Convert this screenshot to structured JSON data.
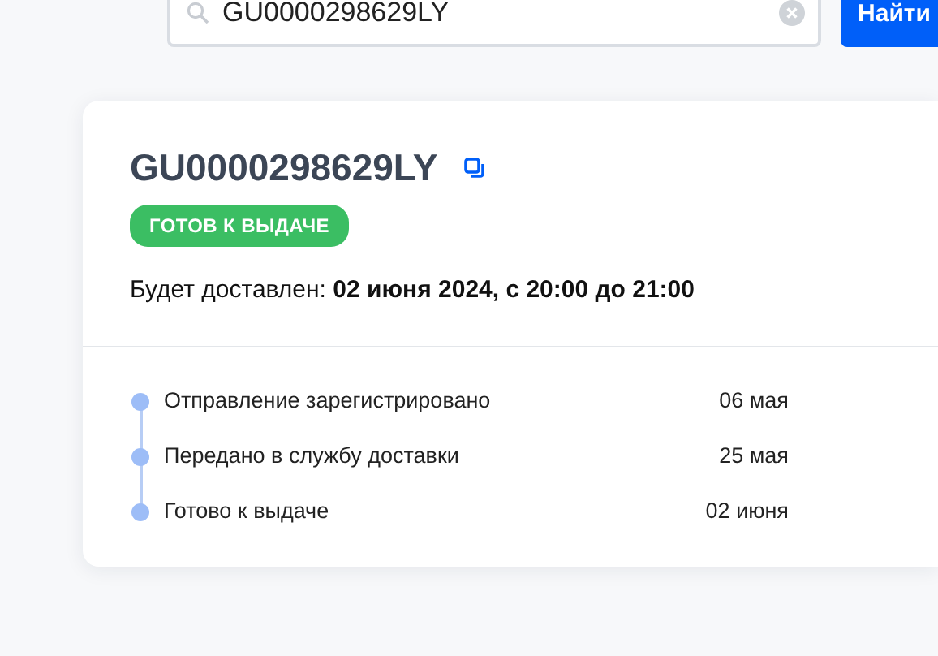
{
  "search": {
    "value": "GU0000298629LY",
    "button": "Найти"
  },
  "shipment": {
    "tracking_number": "GU0000298629LY",
    "status": "ГОТОВ К ВЫДАЧЕ",
    "delivery_label": "Будет доставлен:",
    "delivery_time": "02 июня 2024, с 20:00 до 21:00"
  },
  "history": [
    {
      "event": "Отправление зарегистрировано",
      "date": "06 мая"
    },
    {
      "event": "Передано в службу доставки",
      "date": "25 мая"
    },
    {
      "event": "Готово к выдаче",
      "date": "02 июня"
    }
  ]
}
